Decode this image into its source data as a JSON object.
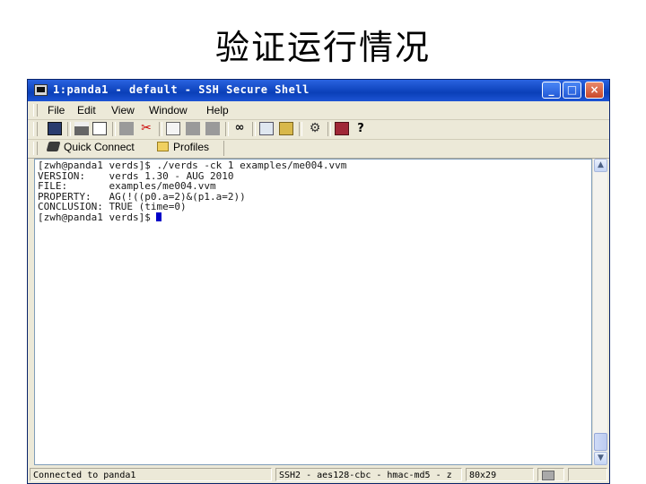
{
  "slide": {
    "title": "验证运行情况"
  },
  "window": {
    "title": "1:panda1 - default - SSH Secure Shell",
    "controls": {
      "minimize": "_",
      "maximize": "□",
      "close": "×"
    }
  },
  "menu": {
    "items": [
      "File",
      "Edit",
      "View",
      "Window",
      "Help"
    ]
  },
  "toolbar": {
    "icons": [
      "save-icon",
      "print-icon",
      "print-preview-icon",
      "disk-icon",
      "cut-icon",
      "copy-icon",
      "paste-icon",
      "paste-gray-icon",
      "find-icon",
      "new-terminal-icon",
      "new-file-transfer-icon",
      "settings-icon",
      "help-book-icon",
      "context-help-icon"
    ]
  },
  "profile_bar": {
    "quick_connect": "Quick Connect",
    "profiles": "Profiles"
  },
  "terminal": {
    "lines": [
      "[zwh@panda1 verds]$ ./verds -ck 1 examples/me004.vvm",
      "VERSION:    verds 1.30 - AUG 2010",
      "FILE:       examples/me004.vvm",
      "PROPERTY:   AG(!((p0.a=2)&(p1.a=2))",
      "CONCLUSION: TRUE (time=0)",
      "[zwh@panda1 verds]$ "
    ]
  },
  "statusbar": {
    "connection": "Connected to panda1",
    "cipher": "SSH2 - aes128-cbc - hmac-md5 - z",
    "size": "80x29"
  }
}
